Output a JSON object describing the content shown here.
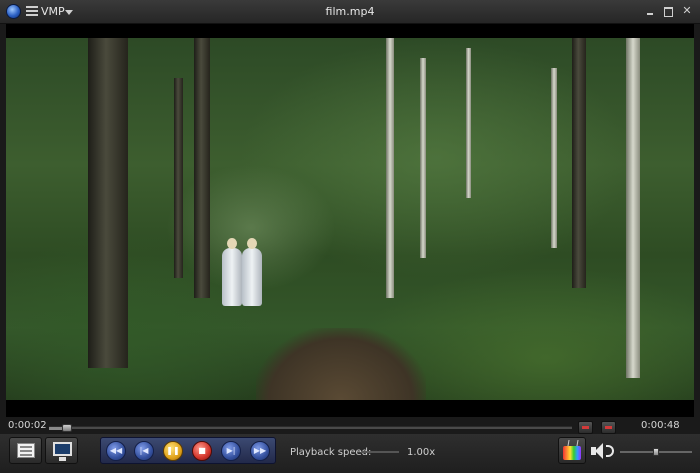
{
  "window": {
    "app_menu_label": "VMP",
    "title": "film.mp4"
  },
  "playback": {
    "elapsed": "0:00:02",
    "total": "0:00:48",
    "progress_fraction": 0.035,
    "state": "playing"
  },
  "speed": {
    "label": "Playback speed:",
    "value": "1.00x"
  },
  "volume": {
    "level_fraction": 0.5
  },
  "icons": {
    "app_logo": "app-logo-icon",
    "menu": "menu-icon",
    "playlist": "playlist-icon",
    "screen": "monitor-icon",
    "rewind": "rewind-icon",
    "previous": "skip-back-icon",
    "pause": "pause-icon",
    "stop": "stop-icon",
    "next": "skip-forward-icon",
    "forward": "fast-forward-icon",
    "tv": "tv-icon",
    "volume": "speaker-icon"
  },
  "colors": {
    "accent_transport": "#34509e",
    "pause": "#e0a21a",
    "stop": "#d2332a"
  }
}
